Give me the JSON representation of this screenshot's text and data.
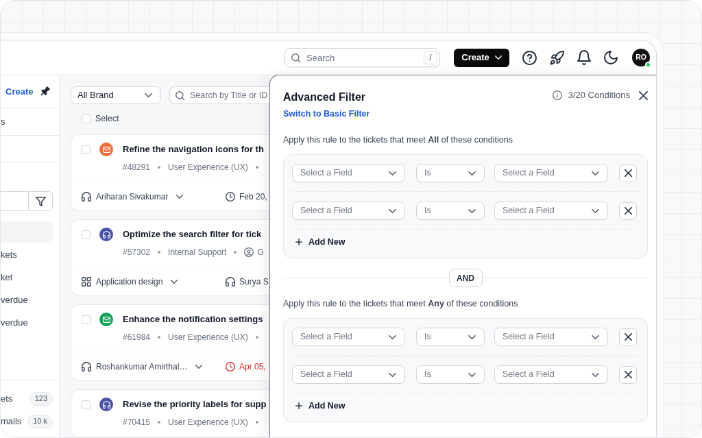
{
  "topbar": {
    "search": {
      "placeholder": "Search",
      "shortcut": "/"
    },
    "create_button": "Create",
    "user": {
      "initials": "RO",
      "online": true
    }
  },
  "sidebar": {
    "create_link": "Create",
    "rows": [
      {
        "label": "s"
      }
    ],
    "nav_items": [
      {
        "selected": true
      },
      {
        "label": "kets",
        "selected": false
      },
      {
        "label": "ket",
        "selected": false
      },
      {
        "label": "verdue",
        "selected": false
      },
      {
        "label": "verdue",
        "selected": false
      }
    ],
    "queues": [
      {
        "label": "ets",
        "count": "123"
      },
      {
        "label": "mails",
        "count": "10 k"
      }
    ]
  },
  "ticket_list": {
    "brand_filter": "All Brand",
    "search": {
      "placeholder": "Search by Title or ID"
    },
    "select_all": {
      "label": "Select",
      "checked": false
    },
    "tickets": [
      {
        "checked": false,
        "kind": "email",
        "color": "#f26b3a",
        "title": "Refine the navigation icons for th",
        "meta": [
          {
            "kind": "id",
            "text": "#48291"
          },
          {
            "kind": "team",
            "text": "User Experience (UX)"
          }
        ],
        "meta_continues": true,
        "footer": [
          {
            "kind": "agent",
            "text": "Ariharan Sivakumar",
            "dropdown": true
          },
          {
            "kind": "due",
            "text": "Feb 20,",
            "overdue": false
          }
        ]
      },
      {
        "checked": false,
        "kind": "phone",
        "color": "#4b55a8",
        "title": "Optimize the search filter for tick",
        "meta": [
          {
            "kind": "id",
            "text": "#57302"
          },
          {
            "kind": "team",
            "text": "Internal Support"
          },
          {
            "kind": "assignee",
            "text": "G"
          }
        ],
        "meta_continues": false,
        "footer": [
          {
            "kind": "category",
            "text": "Application design",
            "dropdown": true
          },
          {
            "kind": "agent",
            "text": "Surya S",
            "dropdown": false
          }
        ]
      },
      {
        "checked": false,
        "kind": "email",
        "color": "#16a05a",
        "title": "Enhance the notification settings",
        "meta": [
          {
            "kind": "id",
            "text": "#61984"
          },
          {
            "kind": "team",
            "text": "User Experience (UX)"
          }
        ],
        "meta_continues": true,
        "footer": [
          {
            "kind": "agent",
            "text": "Roshankumar Amirthal…",
            "dropdown": true
          },
          {
            "kind": "due",
            "text": "Apr 05,",
            "overdue": true
          }
        ]
      },
      {
        "checked": false,
        "kind": "phone",
        "color": "#4b55a8",
        "title": "Revise the priority labels for supp",
        "meta": [
          {
            "kind": "id",
            "text": "#70415"
          },
          {
            "kind": "team",
            "text": "User Experience (UX)"
          }
        ],
        "meta_continues": true
      }
    ]
  },
  "filter_panel": {
    "title": "Advanced Filter",
    "switch_link": "Switch to Basic Filter",
    "conditions_count": "3/20 Conditions",
    "connector": "AND",
    "groups": [
      {
        "description": "Apply this rule to the tickets that meet **All** of these conditions",
        "conditions": [
          {
            "field": {
              "placeholder": "Select a Field"
            },
            "operator": {
              "value": "Is"
            },
            "value": {
              "placeholder": "Select a Field"
            }
          },
          {
            "field": {
              "placeholder": "Select a Field"
            },
            "operator": {
              "value": "Is"
            },
            "value": {
              "placeholder": "Select a Field"
            }
          }
        ],
        "add_label": "Add New"
      },
      {
        "description": "Apply this rule to the tickets that meet **Any** of these conditions",
        "conditions": [
          {
            "field": {
              "placeholder": "Select a Field"
            },
            "operator": {
              "value": "Is"
            },
            "value": {
              "placeholder": "Select a Field"
            }
          },
          {
            "field": {
              "placeholder": "Select a Field"
            },
            "operator": {
              "value": "Is"
            },
            "value": {
              "placeholder": "Select a Field"
            }
          }
        ],
        "add_label": "Add New"
      }
    ]
  }
}
